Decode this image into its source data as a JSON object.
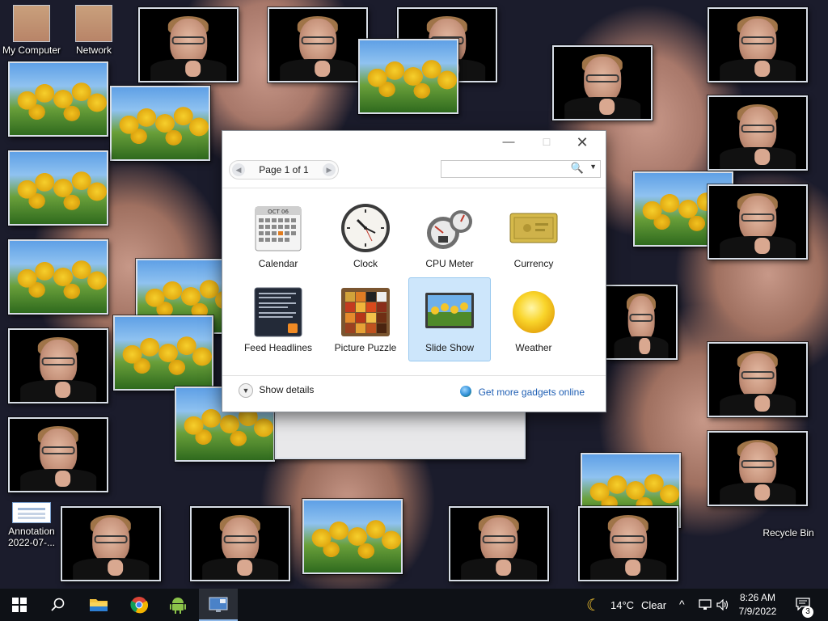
{
  "desktop": {
    "icons": [
      {
        "label": "My Computer"
      },
      {
        "label": "Network"
      },
      {
        "label": "Annotation 2022-07-..."
      },
      {
        "label": "Recycle Bin"
      }
    ]
  },
  "dialog": {
    "title_buttons": {
      "minimize": "—",
      "maximize": "☐",
      "close": "✕"
    },
    "pager": {
      "label": "Page 1 of 1",
      "prev": "◀",
      "next": "▶"
    },
    "search": {
      "value": "",
      "icon": "🔍",
      "dropdown": "▼"
    },
    "gadgets": [
      {
        "label": "Calendar",
        "icon": "calendar-icon",
        "selected": false
      },
      {
        "label": "Clock",
        "icon": "clock-icon",
        "selected": false
      },
      {
        "label": "CPU Meter",
        "icon": "cpu-meter-icon",
        "selected": false
      },
      {
        "label": "Currency",
        "icon": "currency-icon",
        "selected": false
      },
      {
        "label": "Feed Headlines",
        "icon": "feed-headlines-icon",
        "selected": false
      },
      {
        "label": "Picture Puzzle",
        "icon": "picture-puzzle-icon",
        "selected": false
      },
      {
        "label": "Slide Show",
        "icon": "slide-show-icon",
        "selected": true
      },
      {
        "label": "Weather",
        "icon": "weather-icon",
        "selected": false
      }
    ],
    "calendar_icon_text": "OCT 06",
    "footer": {
      "show_details": "Show details",
      "get_more": "Get more gadgets online"
    }
  },
  "taskbar": {
    "weather": {
      "temp": "14°C",
      "condition": "Clear"
    },
    "clock": {
      "time": "8:26 AM",
      "date": "7/9/2022"
    },
    "notifications": "3"
  },
  "colors": {
    "accent": "#1f5fb4",
    "selection": "#cde6fb",
    "taskbar": "#0e1116"
  }
}
